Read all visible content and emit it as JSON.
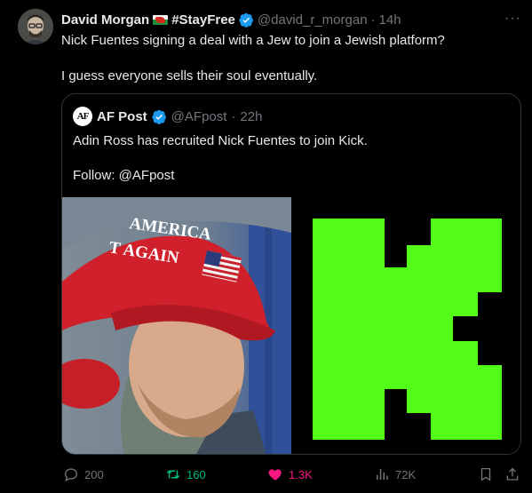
{
  "author": {
    "name": "David Morgan",
    "flag_icon": "wales-flag-icon",
    "hashtag": "#StayFree",
    "verified_icon": "verified-badge-icon",
    "handle": "@david_r_morgan",
    "separator": "·",
    "time": "14h"
  },
  "more_label": "···",
  "tweet": {
    "line1": "Nick Fuentes signing a deal with a Jew to join a Jewish platform?",
    "line2": "I guess everyone sells their soul eventually."
  },
  "quote": {
    "avatar_text": "AF",
    "name": "AF Post",
    "handle": "@AFpost",
    "separator": "·",
    "time": "22h",
    "line1": "Adin Ross has recruited Nick Fuentes to join Kick.",
    "line2": "Follow: @AFpost",
    "hat_line1": "AMERICA",
    "hat_line2": "T AGAIN"
  },
  "actions": {
    "reply_count": "200",
    "retweet_count": "160",
    "like_count": "1.3K",
    "views_count": "72K"
  },
  "colors": {
    "background": "#000000",
    "text": "#e7e9ea",
    "muted": "#71767b",
    "retweet": "#00ba7c",
    "like": "#f91880",
    "verified": "#1d9bf0",
    "kick_green": "#53fc18"
  }
}
